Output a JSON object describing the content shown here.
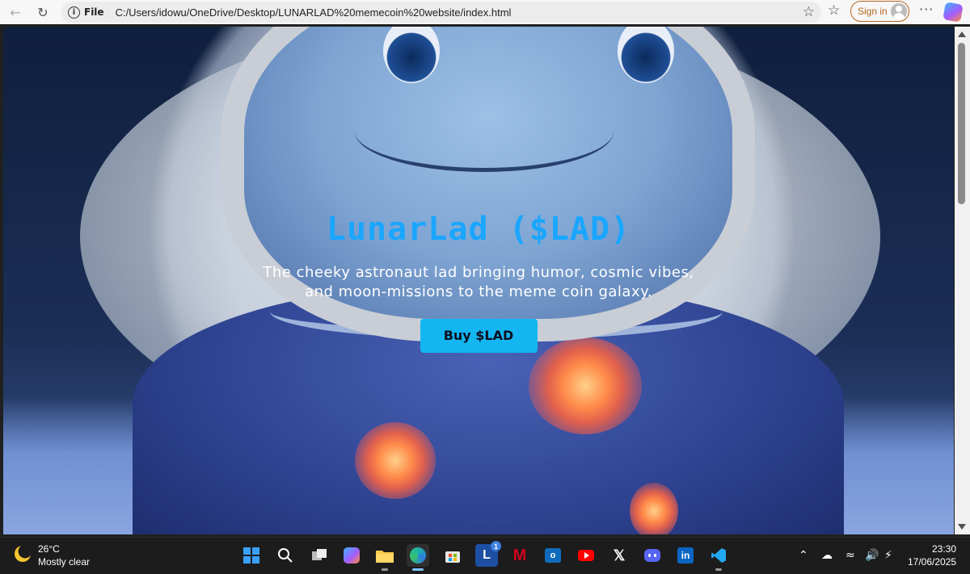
{
  "browser": {
    "file_label": "File",
    "url": "C:/Users/idowu/OneDrive/Desktop/LUNARLAD%20memecoin%20website/index.html",
    "sign_in_label": "Sign in",
    "more_label": "···"
  },
  "page": {
    "title": "LunarLad ($LAD)",
    "subtitle_line1": "The cheeky astronaut lad bringing humor, cosmic vibes,",
    "subtitle_line2": "and moon-missions to the meme coin galaxy.",
    "buy_button": "Buy $LAD",
    "accent_color": "#1aa6ff",
    "button_color": "#14b6f2"
  },
  "taskbar": {
    "weather_temp": "26°C",
    "weather_desc": "Mostly clear",
    "apps": [
      "windows-start",
      "search",
      "task-view",
      "copilot",
      "file-explorer",
      "edge",
      "microsoft-store",
      "lexis",
      "mcafee",
      "outlook",
      "youtube",
      "x",
      "discord",
      "linkedin",
      "vscode"
    ],
    "lexis_badge": "1",
    "time": "23:30",
    "date": "17/06/2025"
  }
}
